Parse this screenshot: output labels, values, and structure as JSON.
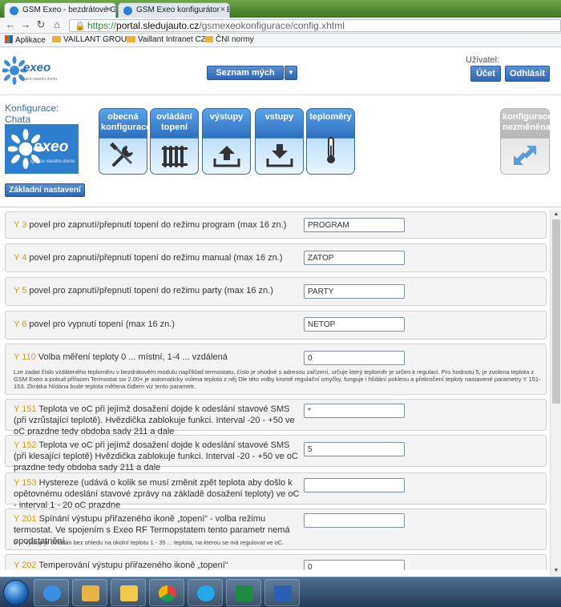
{
  "browser": {
    "tabs": [
      {
        "title": "GSM Exeo - bezdrátové GS"
      },
      {
        "title": "GSM Exeo konfigurátor - E"
      }
    ],
    "url_scheme": "https://",
    "url_host": "portal.sledujauto.cz",
    "url_path": "/gsmexeokonfigurace/config.xhtml",
    "bookmarks": [
      "Aplikace",
      "VAILLANT GROUP",
      "Vaillant Intranet CZ",
      "ČNI normy"
    ]
  },
  "header": {
    "logo_word": "exeo",
    "logo_sub": "ignace vaseho domu",
    "dropdown_label": "Seznam mých GSM",
    "user_label": "Uživatel:",
    "account_button": "Účet",
    "logout_button": "Odhlásit"
  },
  "config": {
    "title_line1": "Konfigurace:",
    "title_line2": "Chata",
    "big_logo_word": "exeo",
    "big_logo_sub": "ignace vaseho domu",
    "basic_settings_button": "Základní nastavení",
    "tiles": [
      {
        "label": "obecná konfigurace",
        "icon": "tools-icon"
      },
      {
        "label": "ovládání topení",
        "icon": "radiator-icon"
      },
      {
        "label": "výstupy",
        "icon": "upload-icon"
      },
      {
        "label": "vstupy",
        "icon": "download-icon"
      },
      {
        "label": "teploměry",
        "icon": "thermometer-icon"
      }
    ],
    "status_tile": {
      "label": "konfigurace nezměněna",
      "icon": "sync-arrows-icon"
    }
  },
  "params": [
    {
      "code": "Y 3",
      "label": "povel pro zapnutí/přepnutí topení do režimu program (max 16 zn.)",
      "value": "PROGRAM"
    },
    {
      "code": "Y 4",
      "label": "povel pro zapnutí/přepnutí topení do režimu manual (max 16 zn.)",
      "value": "ZATOP"
    },
    {
      "code": "Y 5",
      "label": "povel pro zapnutí/přepnutí topení do režimu party (max 16 zn.)",
      "value": "PARTY"
    },
    {
      "code": "Y 6",
      "label": "povel pro vypnutí topení (max 16 zn.)",
      "value": "NETOP"
    },
    {
      "code": "Y 110",
      "label": "Volba měření teploty 0 ... místní, 1-4 ... vzdálená",
      "value": "0",
      "desc": "Lze zadat číslo vzdáleného teploměru v bezdrátovém modulu například termostatu, číslo je shodné s adresou zařízení, určuje který teploměr je určen k regulaci. Pro hodnotu 5, je zvolena teplota z GSM Exeo a pokud přiřazen Termostat sw 2.00+ je automaticky volena teplota z něj Dle této volby kromě regulační smyčky, funguje i hlídání poklesu a překročení teploty nastavené parametry Y 151-153. Zkrátka hlídána bude teplota měřena čidlem viz tento parametr."
    },
    {
      "code": "Y 151",
      "label": "Teplota ve oC při jejímž dosažení dojde k odeslání stavové SMS (při vzrůstající teplotě). Hvězdička zablokuje funkci. Interval -20 - +50 ve oC prazdne tedy obdoba sady 211 a dale",
      "value": "*"
    },
    {
      "code": "Y 152",
      "label": "Teplota ve oC při jejímž dosažení dojde k odeslání stavové SMS (při klesající teplotě) Hvězdička zablokuje funkci. Interval -20 - +50 ve oC prazdne tedy obdoba sady 211 a dale",
      "value": "5"
    },
    {
      "code": "Y 153",
      "label": "Hystereze (udává o kolik se musí změnit zpět teplota aby došlo k opětovnému odeslání stavové zprávy na základě dosažení teploty) ve oC - interval 1 - 20 oC prazdne",
      "value": ""
    },
    {
      "code": "Y 201",
      "label": "Spínání výstupu přiřazeného ikoně „topení“ - volba režimu termostat. Ve spojením s Exeo RF Termopstatem tento parametr nemá opodstatnění.",
      "value": "",
      "desc": "0 ... výstup je ovládán bez ohledu na okolní teplotu 1 - 35 ... teplota, na kterou se má regulovat ve oC."
    },
    {
      "code": "Y 202",
      "label": "Temperování výstupu přiřazeného ikoně „topení“",
      "value": "0"
    }
  ],
  "colors": {
    "accent": "#2e67b3",
    "param_code": "#d79b22",
    "taskbar": "#233b58"
  },
  "taskbar": {
    "apps": [
      "ie-icon",
      "folder-icon",
      "outlook-icon",
      "chrome-icon",
      "skype-icon",
      "excel-icon",
      "word-icon"
    ]
  }
}
